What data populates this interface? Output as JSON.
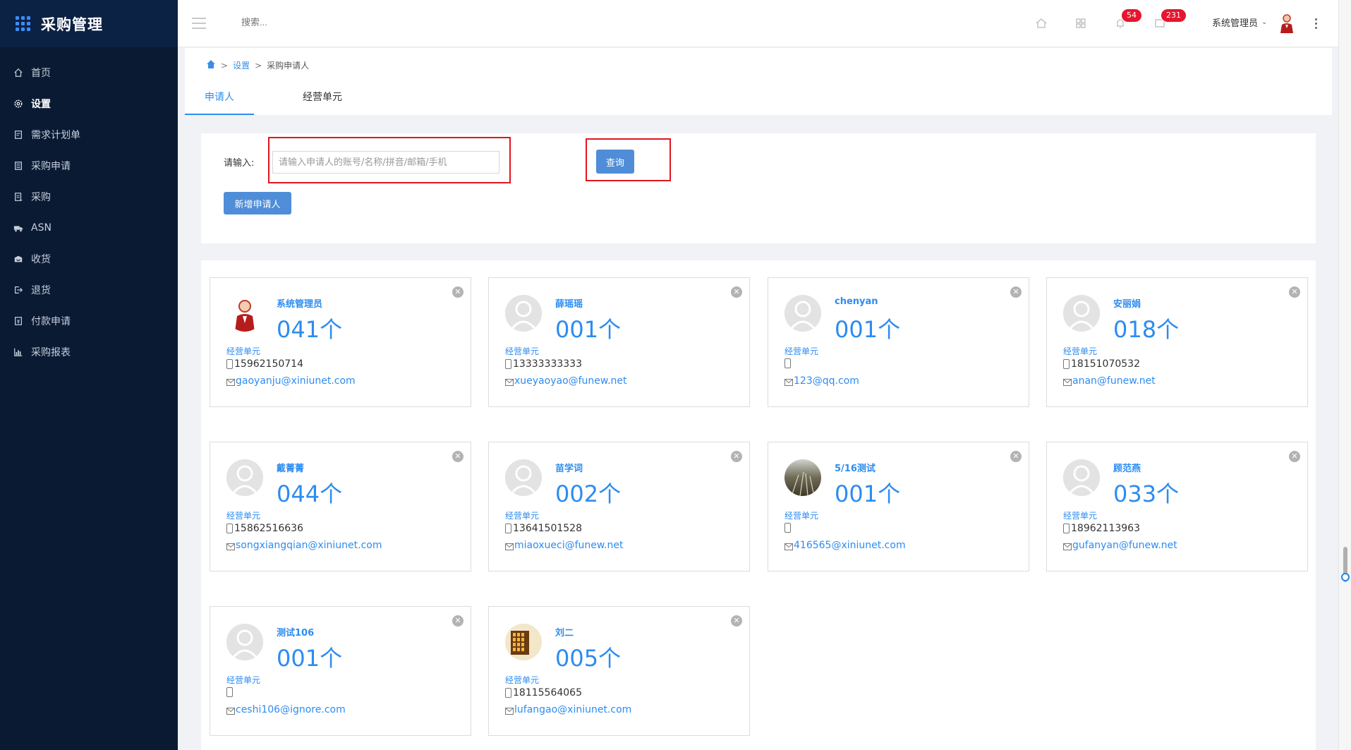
{
  "app": {
    "title": "采购管理"
  },
  "sidebar": {
    "items": [
      {
        "label": "首页",
        "icon": "home-icon"
      },
      {
        "label": "设置",
        "icon": "gear-icon",
        "active": true
      },
      {
        "label": "需求计划单",
        "icon": "document-icon"
      },
      {
        "label": "采购申请",
        "icon": "list-icon"
      },
      {
        "label": "采购",
        "icon": "purchase-icon"
      },
      {
        "label": "ASN",
        "icon": "truck-icon"
      },
      {
        "label": "收货",
        "icon": "receive-icon"
      },
      {
        "label": "退货",
        "icon": "return-icon"
      },
      {
        "label": "付款申请",
        "icon": "payment-icon"
      },
      {
        "label": "采购报表",
        "icon": "bar-chart-icon"
      }
    ]
  },
  "header": {
    "search_placeholder": "搜索...",
    "notifications_badge": "54",
    "messages_badge": "231",
    "username": "系统管理员"
  },
  "breadcrumb": {
    "level1": "设置",
    "level2": "采购申请人"
  },
  "tabs": [
    {
      "label": "申请人",
      "active": true
    },
    {
      "label": "经营单元",
      "active": false
    }
  ],
  "search_panel": {
    "label": "请输入:",
    "input_placeholder": "请输入申请人的账号/名称/拼音/邮箱/手机",
    "input_value": "",
    "query_button": "查询",
    "add_button": "新增申请人"
  },
  "cards": [
    {
      "name": "系统管理员",
      "count": "041个",
      "unit": "经营单元",
      "phone": "15962150714",
      "email": "gaoyanju@xiniunet.com",
      "avatar": "admin"
    },
    {
      "name": "薛瑶瑶",
      "count": "001个",
      "unit": "经营单元",
      "phone": "13333333333",
      "email": "xueyaoyao@funew.net",
      "avatar": "default"
    },
    {
      "name": "chenyan",
      "count": "001个",
      "unit": "经营单元",
      "phone": "",
      "email": "123@qq.com",
      "avatar": "default"
    },
    {
      "name": "安丽娟",
      "count": "018个",
      "unit": "经营单元",
      "phone": "18151070532",
      "email": "anan@funew.net",
      "avatar": "default"
    },
    {
      "name": "戴菁菁",
      "count": "044个",
      "unit": "经营单元",
      "phone": "15862516636",
      "email": "songxiangqian@xiniunet.com",
      "avatar": "default"
    },
    {
      "name": "苗学词",
      "count": "002个",
      "unit": "经营单元",
      "phone": "13641501528",
      "email": "miaoxueci@funew.net",
      "avatar": "default"
    },
    {
      "name": "5/16测试",
      "count": "001个",
      "unit": "经营单元",
      "phone": "",
      "email": "416565@xiniunet.com",
      "avatar": "photo-grass"
    },
    {
      "name": "顾范燕",
      "count": "033个",
      "unit": "经营单元",
      "phone": "18962113963",
      "email": "gufanyan@funew.net",
      "avatar": "default"
    },
    {
      "name": "测试106",
      "count": "001个",
      "unit": "经营单元",
      "phone": "",
      "email": "ceshi106@ignore.com",
      "avatar": "default"
    },
    {
      "name": "刘二",
      "count": "005个",
      "unit": "经营单元",
      "phone": "18115564065",
      "email": "lufangao@xiniunet.com",
      "avatar": "photo-window"
    }
  ],
  "colors": {
    "sidebar_bg": "#0a1a33",
    "accent": "#2d8cf0",
    "button": "#4f8dd8",
    "highlight_box": "#e0161f",
    "badge": "#e6162d"
  }
}
